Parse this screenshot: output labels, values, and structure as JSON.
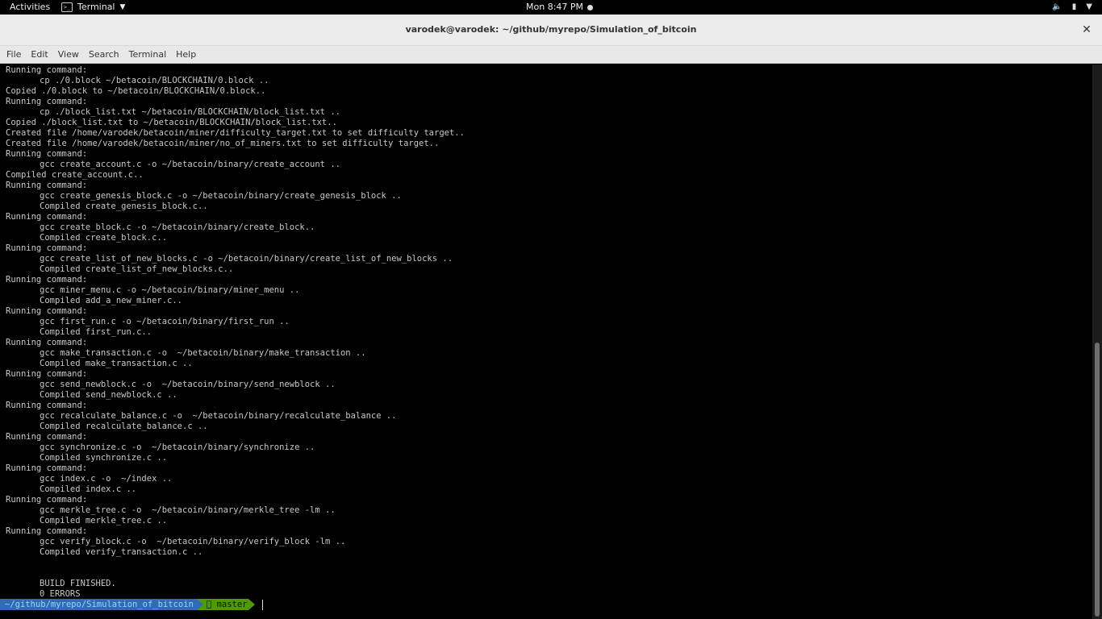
{
  "topbar": {
    "activities": "Activities",
    "app_name": "Terminal",
    "clock": "Mon  8:47 PM",
    "tray_icons": [
      "volume-icon",
      "battery-icon",
      "system-menu-icon"
    ]
  },
  "window": {
    "title": "varodek@varodek: ~/github/myrepo/Simulation_of_bitcoin"
  },
  "menu": [
    "File",
    "Edit",
    "View",
    "Search",
    "Terminal",
    "Help"
  ],
  "terminal": {
    "lines": [
      {
        "t": "Running command:",
        "i": 0
      },
      {
        "t": "cp ./0.block ~/betacoin/BLOCKCHAIN/0.block ..",
        "i": 1
      },
      {
        "t": "Copied ./0.block to ~/betacoin/BLOCKCHAIN/0.block..",
        "i": 0
      },
      {
        "t": "Running command:",
        "i": 0
      },
      {
        "t": "cp ./block_list.txt ~/betacoin/BLOCKCHAIN/block_list.txt ..",
        "i": 1
      },
      {
        "t": "Copied ./block_list.txt to ~/betacoin/BLOCKCHAIN/block_list.txt..",
        "i": 0
      },
      {
        "t": "Created file /home/varodek/betacoin/miner/difficulty_target.txt to set difficulty target..",
        "i": 0
      },
      {
        "t": "Created file /home/varodek/betacoin/miner/no_of_miners.txt to set difficulty target..",
        "i": 0
      },
      {
        "t": "Running command:",
        "i": 0
      },
      {
        "t": "gcc create_account.c -o ~/betacoin/binary/create_account ..",
        "i": 1
      },
      {
        "t": "Compiled create_account.c..",
        "i": 0
      },
      {
        "t": "Running command:",
        "i": 0
      },
      {
        "t": "gcc create_genesis_block.c -o ~/betacoin/binary/create_genesis_block ..",
        "i": 1
      },
      {
        "t": "Compiled create_genesis_block.c..",
        "i": 1
      },
      {
        "t": "Running command:",
        "i": 0
      },
      {
        "t": "gcc create_block.c -o ~/betacoin/binary/create_block..",
        "i": 1
      },
      {
        "t": "Compiled create_block.c..",
        "i": 1
      },
      {
        "t": "Running command:",
        "i": 0
      },
      {
        "t": "gcc create_list_of_new_blocks.c -o ~/betacoin/binary/create_list_of_new_blocks ..",
        "i": 1
      },
      {
        "t": "Compiled create_list_of_new_blocks.c..",
        "i": 1
      },
      {
        "t": "Running command:",
        "i": 0
      },
      {
        "t": "gcc miner_menu.c -o ~/betacoin/binary/miner_menu ..",
        "i": 1
      },
      {
        "t": "Compiled add_a_new_miner.c..",
        "i": 1
      },
      {
        "t": "Running command:",
        "i": 0
      },
      {
        "t": "gcc first_run.c -o ~/betacoin/binary/first_run ..",
        "i": 1
      },
      {
        "t": "Compiled first_run.c..",
        "i": 1
      },
      {
        "t": "Running command:",
        "i": 0
      },
      {
        "t": "gcc make_transaction.c -o  ~/betacoin/binary/make_transaction ..",
        "i": 1
      },
      {
        "t": "Compiled make_transaction.c ..",
        "i": 1
      },
      {
        "t": "Running command:",
        "i": 0
      },
      {
        "t": "gcc send_newblock.c -o  ~/betacoin/binary/send_newblock ..",
        "i": 1
      },
      {
        "t": "Compiled send_newblock.c ..",
        "i": 1
      },
      {
        "t": "Running command:",
        "i": 0
      },
      {
        "t": "gcc recalculate_balance.c -o  ~/betacoin/binary/recalculate_balance ..",
        "i": 1
      },
      {
        "t": "Compiled recalculate_balance.c ..",
        "i": 1
      },
      {
        "t": "Running command:",
        "i": 0
      },
      {
        "t": "gcc synchronize.c -o  ~/betacoin/binary/synchronize ..",
        "i": 1
      },
      {
        "t": "Compiled synchronize.c ..",
        "i": 1
      },
      {
        "t": "Running command:",
        "i": 0
      },
      {
        "t": "gcc index.c -o  ~/index ..",
        "i": 1
      },
      {
        "t": "Compiled index.c ..",
        "i": 1
      },
      {
        "t": "Running command:",
        "i": 0
      },
      {
        "t": "gcc merkle_tree.c -o  ~/betacoin/binary/merkle_tree -lm ..",
        "i": 1
      },
      {
        "t": "Compiled merkle_tree.c ..",
        "i": 1
      },
      {
        "t": "Running command:",
        "i": 0
      },
      {
        "t": "gcc verify_block.c -o  ~/betacoin/binary/verify_block -lm ..",
        "i": 1
      },
      {
        "t": "Compiled verify_transaction.c ..",
        "i": 1
      },
      {
        "t": "",
        "i": 0
      },
      {
        "t": "",
        "i": 0
      },
      {
        "t": "BUILD FINISHED.",
        "i": 1
      },
      {
        "t": "0 ERRORS",
        "i": 1
      }
    ]
  },
  "prompt": {
    "path": "~/github/myrepo/Simulation_of_bitcoin",
    "branch": " master"
  }
}
